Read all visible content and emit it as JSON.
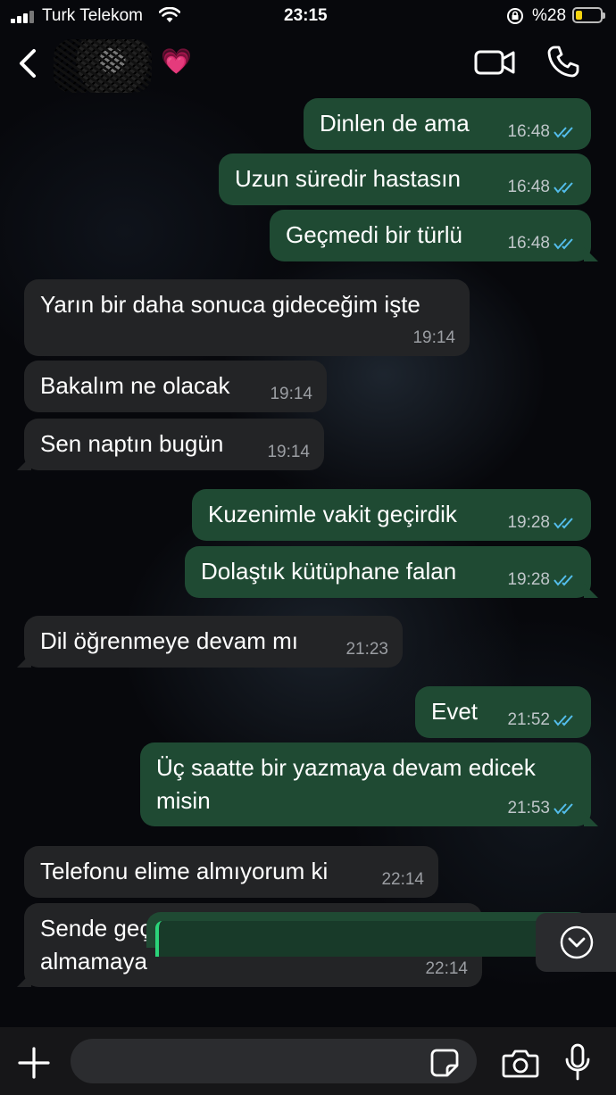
{
  "status_bar": {
    "carrier": "Turk Telekom",
    "time": "23:15",
    "battery_percent": "%28",
    "battery_level": 0.28
  },
  "header": {
    "contact_emoji": "💗",
    "icons": [
      "back-icon",
      "video-call-icon",
      "voice-call-icon"
    ]
  },
  "messages": [
    {
      "dir": "out",
      "text": "Dinlen de ama",
      "time": "16:48",
      "read": true
    },
    {
      "dir": "out",
      "text": "Uzun süredir hastasın",
      "time": "16:48",
      "read": true
    },
    {
      "dir": "out",
      "text": "Geçmedi bir türlü",
      "time": "16:48",
      "read": true
    },
    {
      "dir": "in",
      "text": "Yarın bir daha sonuca gideceğim işte",
      "time": "19:14"
    },
    {
      "dir": "in",
      "text": "Bakalım ne olacak",
      "time": "19:14"
    },
    {
      "dir": "in",
      "text": "Sen naptın bugün",
      "time": "19:14"
    },
    {
      "dir": "out",
      "text": "Kuzenimle vakit geçirdik",
      "time": "19:28",
      "read": true
    },
    {
      "dir": "out",
      "text": "Dolaştık kütüphane falan",
      "time": "19:28",
      "read": true
    },
    {
      "dir": "in",
      "text": "Dil öğrenmeye devam mı",
      "time": "21:23"
    },
    {
      "dir": "out",
      "text": "Evet",
      "time": "21:52",
      "read": true
    },
    {
      "dir": "out",
      "text": "Üç saatte bir yazmaya devam edicek\nmisin",
      "time": "21:53",
      "read": true
    },
    {
      "dir": "in",
      "text": "Telefonu elime almıyorum ki",
      "time": "22:14"
    },
    {
      "dir": "in",
      "text": "Sende geç yazınca iyice alıştım\nalmamaya",
      "time": "22:14"
    }
  ],
  "composer": {
    "input_value": "",
    "icons": [
      "plus-icon",
      "sticker-icon",
      "camera-icon",
      "microphone-icon"
    ]
  },
  "colors": {
    "outgoing_bubble": "#1f4a33",
    "incoming_bubble": "#232426",
    "read_ticks": "#53bdeb"
  }
}
